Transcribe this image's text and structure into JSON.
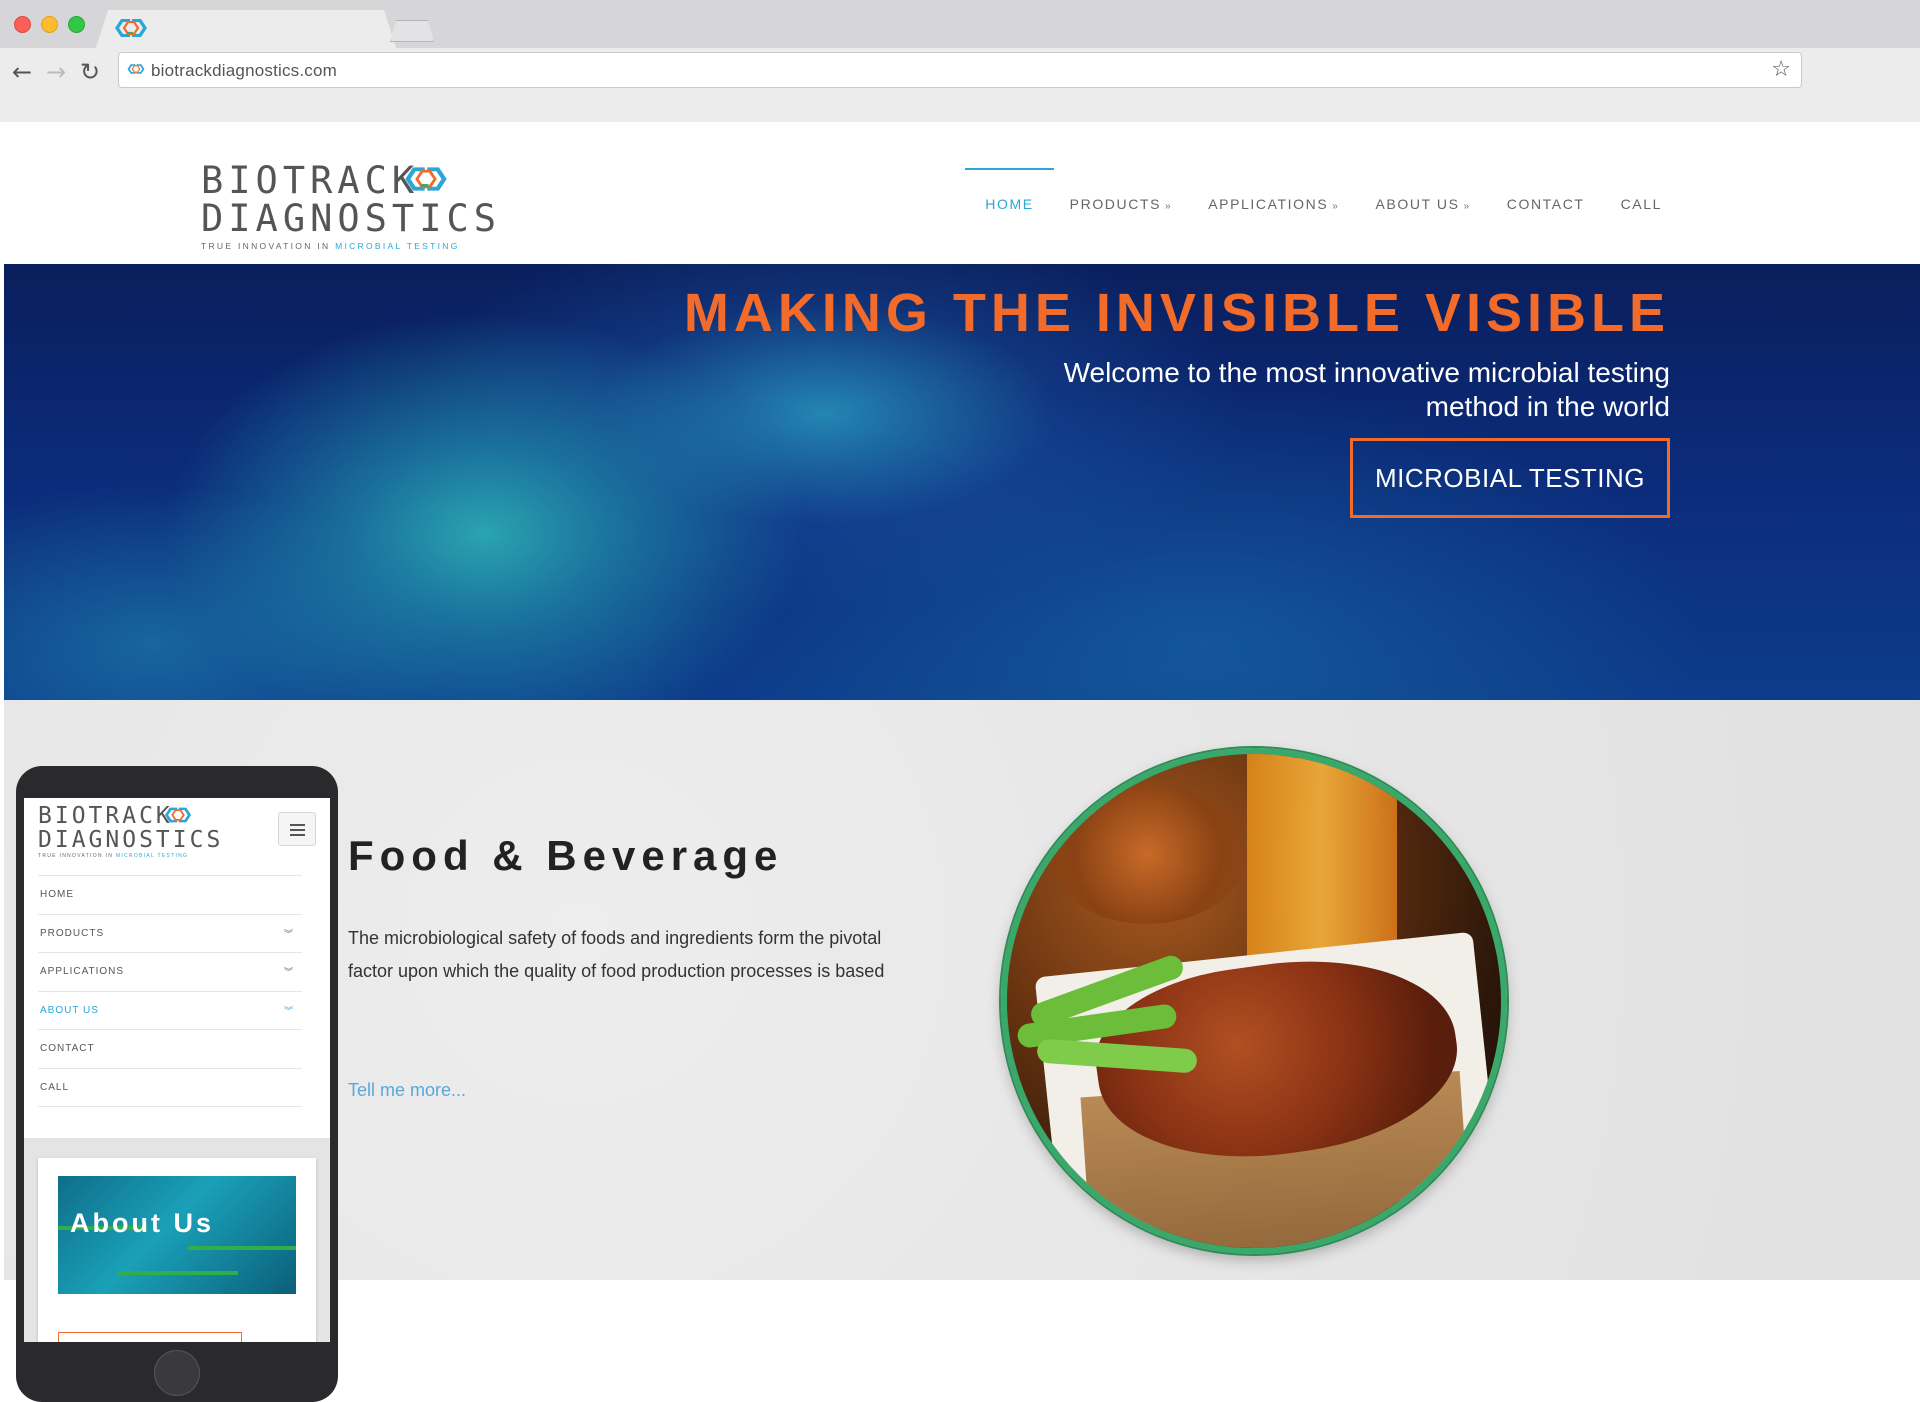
{
  "browser": {
    "url": "biotrackdiagnostics.com"
  },
  "logo": {
    "line1": "BIOTRACK",
    "line2": "DIAGNOSTICS",
    "tagline_part1": "TRUE INNOVATION IN ",
    "tagline_part2": "MICROBIAL TESTING"
  },
  "nav": {
    "items": [
      {
        "label": "HOME",
        "active": true,
        "dropdown": false
      },
      {
        "label": "PRODUCTS",
        "active": false,
        "dropdown": true
      },
      {
        "label": "APPLICATIONS",
        "active": false,
        "dropdown": true
      },
      {
        "label": "ABOUT US",
        "active": false,
        "dropdown": true
      },
      {
        "label": "CONTACT",
        "active": false,
        "dropdown": false
      },
      {
        "label": "CALL",
        "active": false,
        "dropdown": false
      }
    ]
  },
  "hero": {
    "title": "MAKING THE INVISIBLE VISIBLE",
    "subtitle": "Welcome to the most innovative microbial testing method in the world",
    "button": "MICROBIAL TESTING"
  },
  "feature": {
    "title": "Food & Beverage",
    "text": "The microbiological safety of foods and ingredients form the pivotal factor upon which the quality of food production processes is based",
    "link": "Tell me more..."
  },
  "mobile": {
    "nav": [
      {
        "label": "HOME",
        "active": false,
        "dropdown": false
      },
      {
        "label": "PRODUCTS",
        "active": false,
        "dropdown": true
      },
      {
        "label": "APPLICATIONS",
        "active": false,
        "dropdown": true
      },
      {
        "label": "ABOUT US",
        "active": true,
        "dropdown": true
      },
      {
        "label": "CONTACT",
        "active": false,
        "dropdown": false
      },
      {
        "label": "CALL",
        "active": false,
        "dropdown": false
      }
    ],
    "card_title": "About Us"
  },
  "colors": {
    "accent_blue": "#2aa7d8",
    "accent_orange": "#f26b2a",
    "ring_green": "#3aa86a"
  }
}
